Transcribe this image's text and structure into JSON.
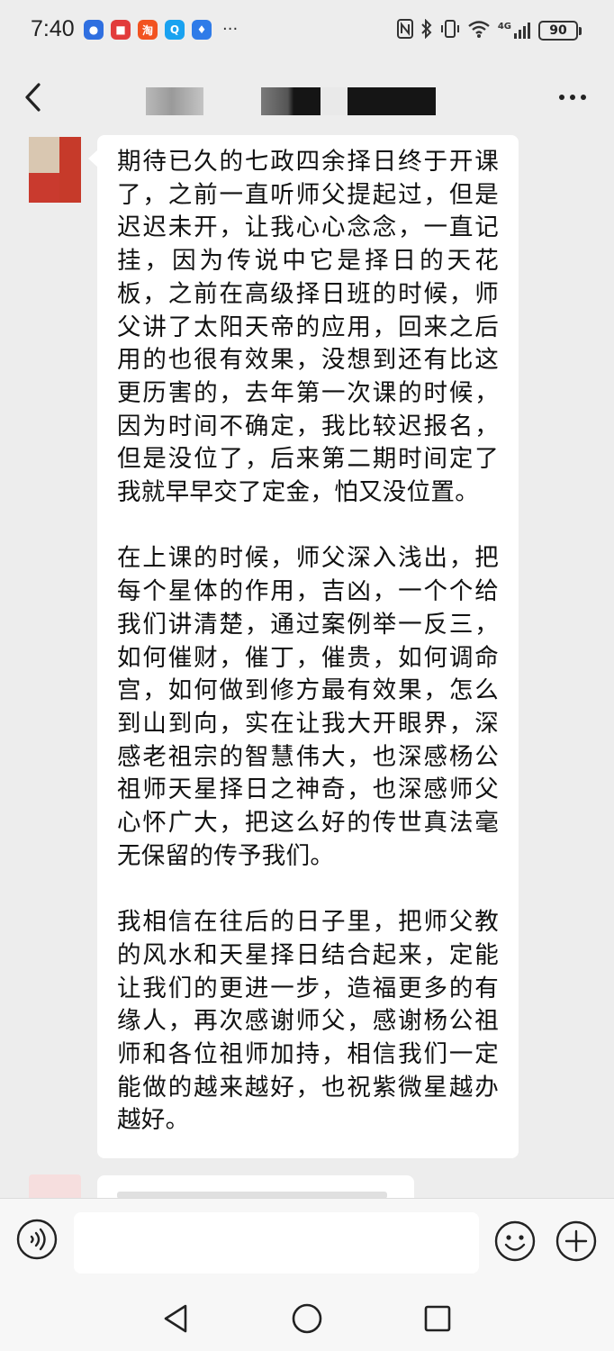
{
  "status_bar": {
    "time": "7:40",
    "more": "···",
    "apps": [
      {
        "icon": "app-blue-icon",
        "glyph": "●",
        "color": "#2f6fe0"
      },
      {
        "icon": "reader-app-icon",
        "glyph": "■",
        "color": "#e23b3b"
      },
      {
        "icon": "taobao-app-icon",
        "glyph": "淘",
        "color": "#f25320"
      },
      {
        "icon": "search-app-icon",
        "glyph": "Q",
        "color": "#1aa2f0"
      },
      {
        "icon": "lightbulb-app-icon",
        "glyph": "♦",
        "color": "#2f7be8"
      }
    ],
    "network": "4G",
    "battery": "90"
  },
  "chat": {
    "paragraphs": [
      "期待已久的七政四余择日终于开课了，之前一直听师父提起过，但是迟迟未开，让我心心念念，一直记挂，因为传说中它是择日的天花板，之前在高级择日班的时候，师父讲了太阳天帝的应用，回来之后用的也很有效果，没想到还有比这更历害的，去年第一次课的时候，因为时间不确定，我比较迟报名，但是没位了，后来第二期时间定了我就早早交了定金，怕又没位置。",
      "在上课的时候，师父深入浅出，把每个星体的作用，吉凶，一个个给我们讲清楚，通过案例举一反三，如何催财，催丁，催贵，如何调命宫，如何做到修方最有效果，怎么到山到向，实在让我大开眼界，深感老祖宗的智慧伟大，也深感杨公祖师天星择日之神奇，也深感师父心怀广大，把这么好的传世真法毫无保留的传予我们。",
      "我相信在往后的日子里，把师父教的风水和天星择日结合起来，定能让我们的更进一步，造福更多的有缘人，再次感谢师父，感谢杨公祖师和各位祖师加持，相信我们一定能做的越来越好，也祝紫微星越办越好。"
    ]
  },
  "input": {
    "value": ""
  },
  "colors": {
    "background": "#ededed",
    "bubble": "#ffffff",
    "input_bar": "#f7f7f7"
  }
}
